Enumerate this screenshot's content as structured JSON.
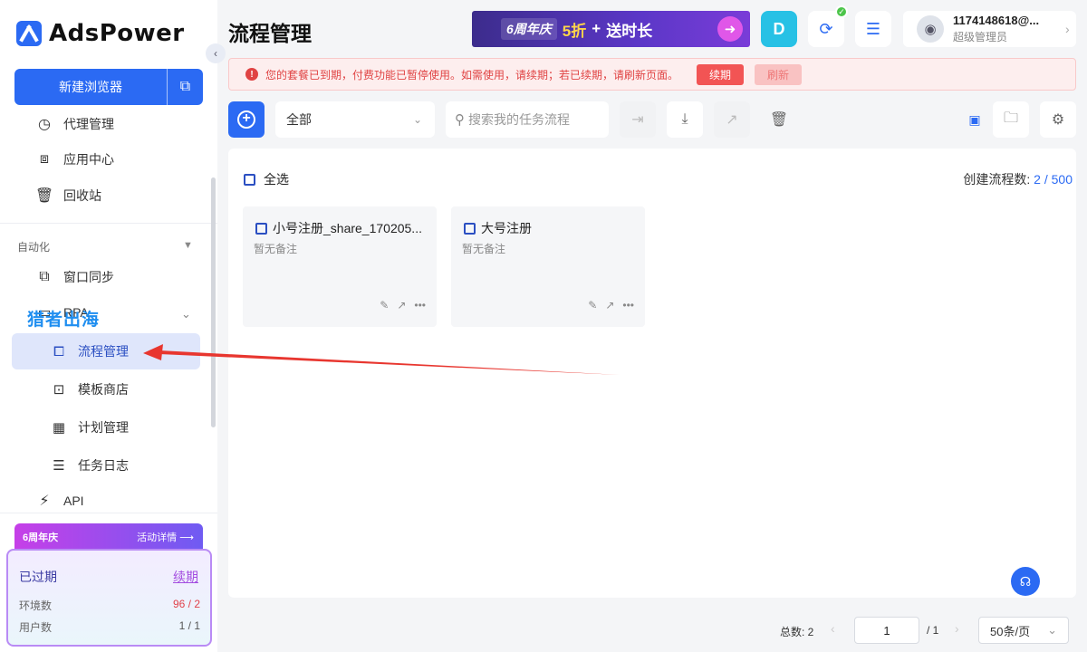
{
  "app": {
    "logo_text": "AdsPower"
  },
  "sidebar": {
    "new_browser": "新建浏览器",
    "top_items": [
      {
        "label": "代理管理",
        "icon": "proxy-icon"
      },
      {
        "label": "应用中心",
        "icon": "puzzle-icon"
      },
      {
        "label": "回收站",
        "icon": "trash-icon"
      }
    ],
    "automation_title": "自动化",
    "automation_items": [
      {
        "label": "窗口同步",
        "icon": "sync-icon"
      },
      {
        "label": "RPA",
        "icon": "robot-icon"
      }
    ],
    "rpa_sub": [
      {
        "label": "流程管理",
        "icon": "flow-icon"
      },
      {
        "label": "模板商店",
        "icon": "store-icon"
      },
      {
        "label": "计划管理",
        "icon": "calendar-icon"
      },
      {
        "label": "任务日志",
        "icon": "log-icon"
      }
    ],
    "api_label": "API",
    "watermark": "猎者出海",
    "promo": {
      "title": "6周年庆",
      "detail": "活动详情 ⟶"
    },
    "plan": {
      "status": "已过期",
      "renew": "续期",
      "env_label": "环境数",
      "env_value": "96 / 2",
      "user_label": "用户数",
      "user_value": "1 / 1"
    }
  },
  "header": {
    "title": "流程管理",
    "banner": {
      "tag": "6周年庆",
      "discount": "5折",
      "plus": "+",
      "text": "送时长"
    },
    "user": {
      "name": "1174148618@...",
      "role": "超级管理员"
    }
  },
  "alert": {
    "message": "您的套餐已到期，付费功能已暂停使用。如需使用，请续期；若已续期，请刷新页面。",
    "renew": "续期",
    "refresh": "刷新"
  },
  "toolbar": {
    "filter_value": "全部",
    "search_placeholder": "搜索我的任务流程"
  },
  "list": {
    "select_all": "全选",
    "count_label": "创建流程数: ",
    "count_value": "2 / 500",
    "cards": [
      {
        "title": "小号注册_share_170205...",
        "note": "暂无备注"
      },
      {
        "title": "大号注册",
        "note": "暂无备注"
      }
    ]
  },
  "pagination": {
    "total": "总数: 2",
    "page": "1",
    "of": "/ 1",
    "page_size": "50条/页"
  },
  "colors": {
    "accent": "#2b6af3",
    "alert": "#e04343",
    "annotation_arrow": "#e8362f"
  }
}
